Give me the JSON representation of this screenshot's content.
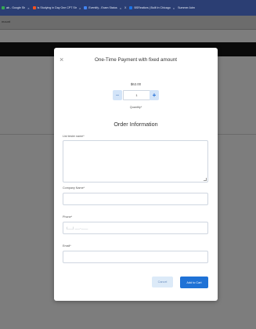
{
  "browser": {
    "tabs": [
      {
        "label": "ab - Google Sh",
        "color": "#34a853"
      },
      {
        "label": "Is Studying in Day One CPT Str",
        "color": "#f4511e"
      },
      {
        "label": "Eventify - Exam Status",
        "color": "#4285f4"
      },
      {
        "label": "X",
        "color": "#2b3e73"
      },
      {
        "label": "BSRealtors | Built In Chicago",
        "color": "#1a73e8"
      },
      {
        "label": "Summer Adm",
        "color": "#2b3e73"
      }
    ],
    "address_text": "mount"
  },
  "modal": {
    "close_symbol": "×",
    "title": "One-Time Payment with fixed amount",
    "price": "$62.00",
    "quantity_value": "1",
    "minus_symbol": "−",
    "plus_symbol": "+",
    "quantity_label": "Quantity*",
    "section_title": "Order Information",
    "fields": {
      "name_label": "List tester name*",
      "company_label": "Company Name*",
      "phone_label": "Phone*",
      "phone_placeholder": "(___) ___-____",
      "email_label": "Email*"
    },
    "cancel_label": "Cancel",
    "add_label": "Add to Cart"
  },
  "colors": {
    "primary": "#1f72d6",
    "secondary_bg": "#dceaf8",
    "tabbar": "#2b3e73"
  }
}
